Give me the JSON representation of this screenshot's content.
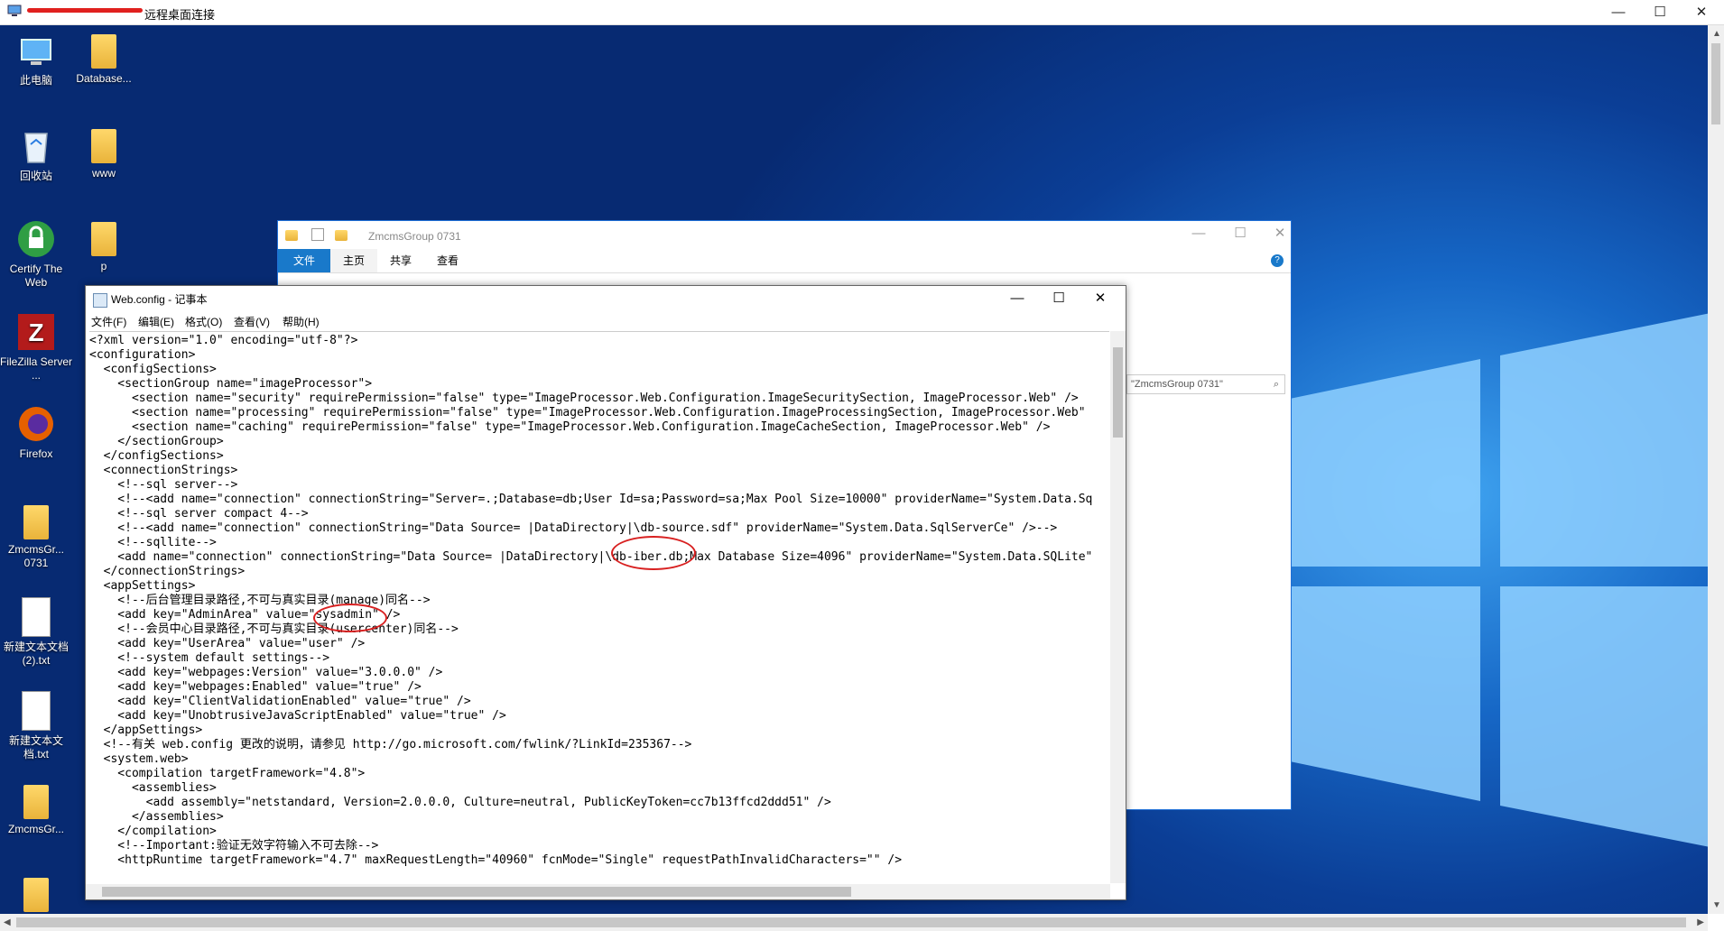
{
  "rdp": {
    "title": "远程桌面连接",
    "minimize": "—",
    "maximize": "☐",
    "close": "✕"
  },
  "desktop": {
    "icons": [
      {
        "label": "此电脑"
      },
      {
        "label": "Database..."
      },
      {
        "label": "回收站"
      },
      {
        "label": "www"
      },
      {
        "label": "Certify The Web"
      },
      {
        "label": "p"
      },
      {
        "label": "FileZilla Server ..."
      },
      {
        "label": "Firefox"
      },
      {
        "label": "ZmcmsGr... 0731"
      },
      {
        "label": "新建文本文档 (2).txt"
      },
      {
        "label": "新建文本文档.txt"
      },
      {
        "label": "ZmcmsGr..."
      }
    ]
  },
  "explorer": {
    "title": "ZmcmsGroup 0731",
    "tabs": [
      "文件",
      "主页",
      "共享",
      "查看"
    ],
    "search_placeholder": "\"ZmcmsGroup 0731\""
  },
  "notepad": {
    "title": "Web.config - 记事本",
    "menu": [
      "文件(F)",
      "编辑(E)",
      "格式(O)",
      "查看(V)",
      "帮助(H)"
    ],
    "lines": [
      "<?xml version=\"1.0\" encoding=\"utf-8\"?>",
      "<configuration>",
      "  <configSections>",
      "    <sectionGroup name=\"imageProcessor\">",
      "      <section name=\"security\" requirePermission=\"false\" type=\"ImageProcessor.Web.Configuration.ImageSecuritySection, ImageProcessor.Web\" />",
      "      <section name=\"processing\" requirePermission=\"false\" type=\"ImageProcessor.Web.Configuration.ImageProcessingSection, ImageProcessor.Web\"",
      "      <section name=\"caching\" requirePermission=\"false\" type=\"ImageProcessor.Web.Configuration.ImageCacheSection, ImageProcessor.Web\" />",
      "    </sectionGroup>",
      "  </configSections>",
      "  <connectionStrings>",
      "    <!--sql server-->",
      "    <!--<add name=\"connection\" connectionString=\"Server=.;Database=db;User Id=sa;Password=sa;Max Pool Size=10000\" providerName=\"System.Data.Sq",
      "    <!--sql server compact 4-->",
      "    <!--<add name=\"connection\" connectionString=\"Data Source= |DataDirectory|\\db-source.sdf\" providerName=\"System.Data.SqlServerCe\" />-->",
      "    <!--sqllite-->",
      "    <add name=\"connection\" connectionString=\"Data Source= |DataDirectory|\\db-iber.db;Max Database Size=4096\" providerName=\"System.Data.SQLite\"",
      "  </connectionStrings>",
      "  <appSettings>",
      "    <!--后台管理目录路径,不可与真实目录(manage)同名-->",
      "    <add key=\"AdminArea\" value=\"sysadmin\" />",
      "    <!--会员中心目录路径,不可与真实目录(usercenter)同名-->",
      "    <add key=\"UserArea\" value=\"user\" />",
      "    <!--system default settings-->",
      "    <add key=\"webpages:Version\" value=\"3.0.0.0\" />",
      "    <add key=\"webpages:Enabled\" value=\"true\" />",
      "    <add key=\"ClientValidationEnabled\" value=\"true\" />",
      "    <add key=\"UnobtrusiveJavaScriptEnabled\" value=\"true\" />",
      "  </appSettings>",
      "  <!--有关 web.config 更改的说明，请参见 http://go.microsoft.com/fwlink/?LinkId=235367-->",
      "  <system.web>",
      "    <compilation targetFramework=\"4.8\">",
      "      <assemblies>",
      "        <add assembly=\"netstandard, Version=2.0.0.0, Culture=neutral, PublicKeyToken=cc7b13ffcd2ddd51\" />",
      "      </assemblies>",
      "    </compilation>",
      "    <!--Important:验证无效字符输入不可去除-->",
      "    <httpRuntime targetFramework=\"4.7\" maxRequestLength=\"40960\" fcnMode=\"Single\" requestPathInvalidCharacters=\"\" />"
    ]
  }
}
